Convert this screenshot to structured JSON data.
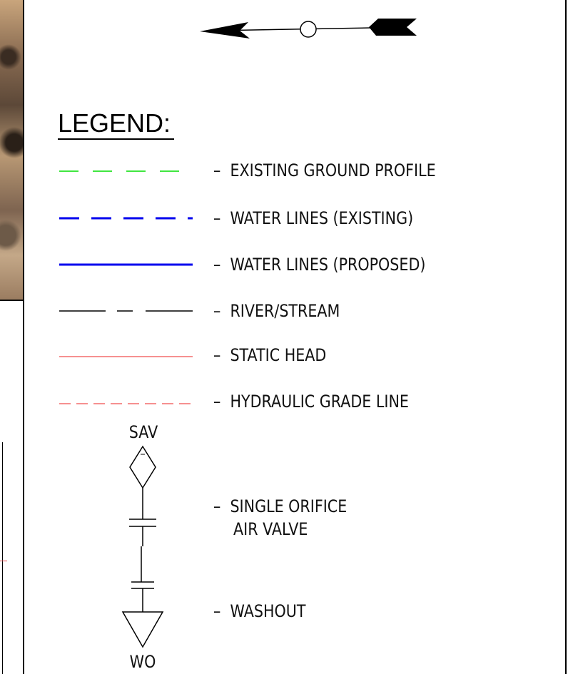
{
  "legend": {
    "title": "LEGEND:",
    "items": [
      {
        "label": "–  EXISTING GROUND PROFILE",
        "color": "#00dd00",
        "style": "dashed"
      },
      {
        "label": "–  WATER LINES (EXISTING)",
        "color": "#0000ee",
        "style": "dashed-bold"
      },
      {
        "label": "–  WATER LINES (PROPOSED)",
        "color": "#0000ee",
        "style": "solid-bold"
      },
      {
        "label": "–  RIVER/STREAM",
        "color": "#000000",
        "style": "dash-dot"
      },
      {
        "label": "–  STATIC HEAD",
        "color": "#ee2222",
        "style": "solid-thin"
      },
      {
        "label": "–  HYDRAULIC GRADE LINE",
        "color": "#ee2222",
        "style": "dashed-thin"
      }
    ],
    "symbols": {
      "sav_tag": "SAV",
      "sav_label_line1": "–  SINGLE ORIFICE",
      "sav_label_line2": "AIR VALVE",
      "wo_label": "–  WASHOUT",
      "wo_tag": "WO"
    }
  },
  "north_arrow": {
    "icon": "north-arrow-icon"
  }
}
